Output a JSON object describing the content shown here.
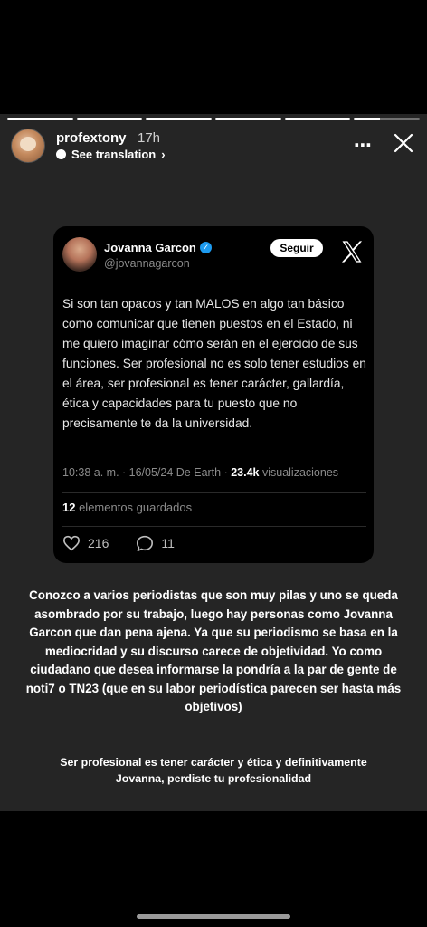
{
  "story": {
    "progress_segments": [
      1,
      1,
      1,
      1,
      1,
      0.4
    ],
    "username": "profextony",
    "time_ago": "17h",
    "see_translation": "See translation",
    "more_icon": "⋯",
    "close_icon": "close-icon"
  },
  "tweet": {
    "author_name": "Jovanna Garcon",
    "handle": "@jovannagarcon",
    "follow_label": "Seguir",
    "text": "Si son tan opacos y tan MALOS en algo tan básico como comunicar que tienen puestos en el Estado, ni me quiero imaginar cómo serán en el ejercicio de sus funciones. Ser profesional no es solo tener estudios en el área, ser profesional es tener carácter, gallardía, ética y capacidades para tu puesto que no precisamente te da la universidad.",
    "timestamp": "10:38 a. m. · 16/05/24 De Earth · ",
    "views_count": "23.4k",
    "views_label": " visualizaciones",
    "saved_count": "12",
    "saved_label": " elementos guardados",
    "likes": "216",
    "replies": "11"
  },
  "caption": {
    "main": "Conozco a varios periodistas que son muy pilas y uno se queda asombrado por su trabajo, luego hay personas como Jovanna Garcon que dan pena ajena. Ya que su periodismo se basa en la mediocridad y su discurso carece de objetividad. Yo como ciudadano que desea informarse la pondría a la par de gente de noti7 o TN23 (que en su labor periodística parecen ser hasta más objetivos)",
    "secondary": "Ser profesional es tener carácter y ética y definitivamente Jovanna, perdiste tu profesionalidad"
  },
  "colors": {
    "story_bg": "#252525",
    "verified": "#1d9bf0"
  }
}
